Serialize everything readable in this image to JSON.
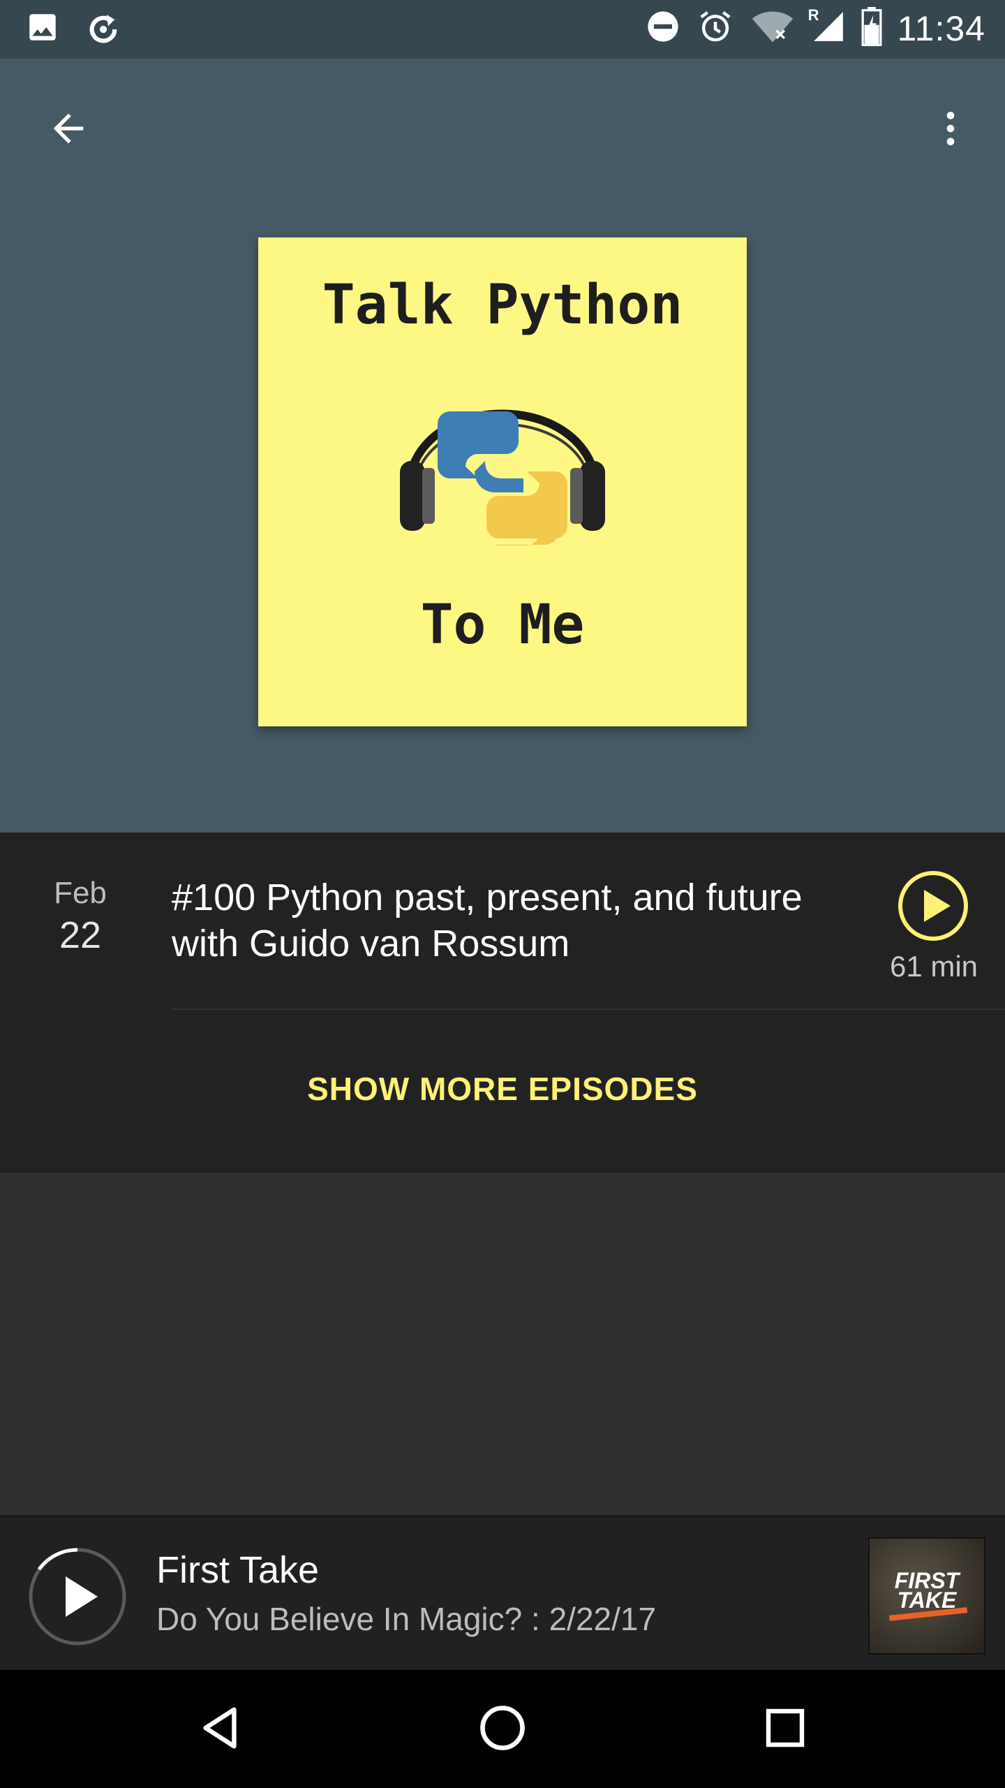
{
  "status_bar": {
    "time": "11:34",
    "icons": [
      "image-icon",
      "sync-icon",
      "do-not-disturb-icon",
      "alarm-icon",
      "wifi-icon",
      "signal-icon",
      "battery-icon"
    ],
    "signal_label": "R"
  },
  "header": {
    "back_icon": "arrow-back-icon",
    "menu_icon": "more-vert-icon",
    "background_color": "#455a64"
  },
  "artwork": {
    "title": "Talk Python",
    "subtitle": "To Me",
    "background_color": "#fdf884"
  },
  "episodes": [
    {
      "month": "Feb",
      "day": "22",
      "title": "#100 Python past, present, and future with Guido van Rossum",
      "duration": "61 min",
      "play_icon": "play-circle-icon"
    }
  ],
  "show_more_label": "SHOW MORE EPISODES",
  "accent_color": "#fff176",
  "now_playing": {
    "title": "First Take",
    "subtitle": "Do You Believe In Magic? : 2/22/17",
    "thumb_text_line1": "FIRST",
    "thumb_text_line2": "TAKE",
    "play_icon": "play-icon"
  },
  "nav_bar": {
    "buttons": [
      "back-triangle-icon",
      "home-circle-icon",
      "recents-square-icon"
    ]
  }
}
